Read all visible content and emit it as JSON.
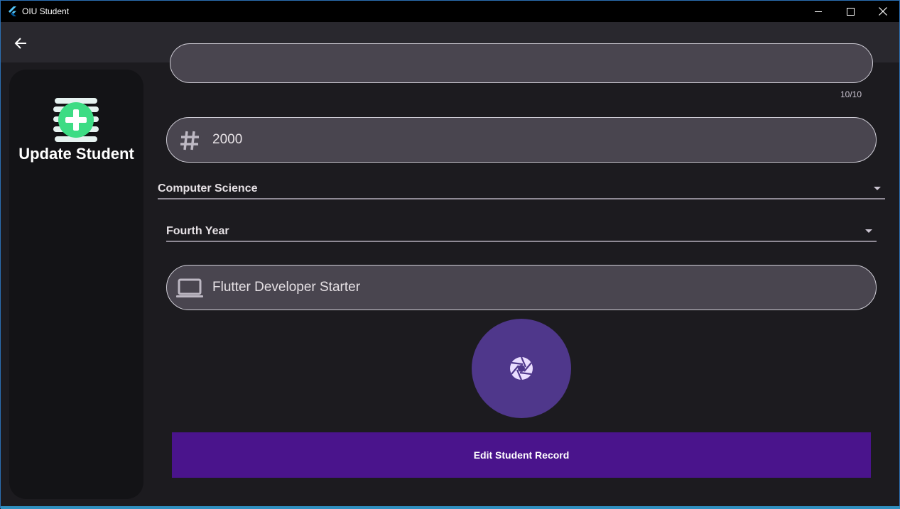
{
  "window": {
    "title": "OIU Student",
    "minimize_icon": "minimize-icon",
    "maximize_icon": "maximize-icon",
    "close_icon": "close-icon"
  },
  "appbar": {
    "back_icon": "arrow-back-icon"
  },
  "sidebar": {
    "icon": "add-student-icon",
    "title": "Update Student"
  },
  "form": {
    "previous_counter": "10/10",
    "year_field": {
      "icon": "hash-icon",
      "value": "2000"
    },
    "department": {
      "value": "Computer Science"
    },
    "level": {
      "value": "Fourth Year"
    },
    "track_field": {
      "icon": "laptop-icon",
      "value": "Flutter Developer Starter"
    },
    "photo_button_icon": "camera-shutter-icon",
    "submit_label": "Edit Student Record"
  },
  "colors": {
    "background": "#1c1b1f",
    "appbar": "#29282e",
    "field_fill": "#49454f",
    "avatar": "#4f378b",
    "submit": "#4a148c",
    "accent_green": "#3ddc84"
  }
}
